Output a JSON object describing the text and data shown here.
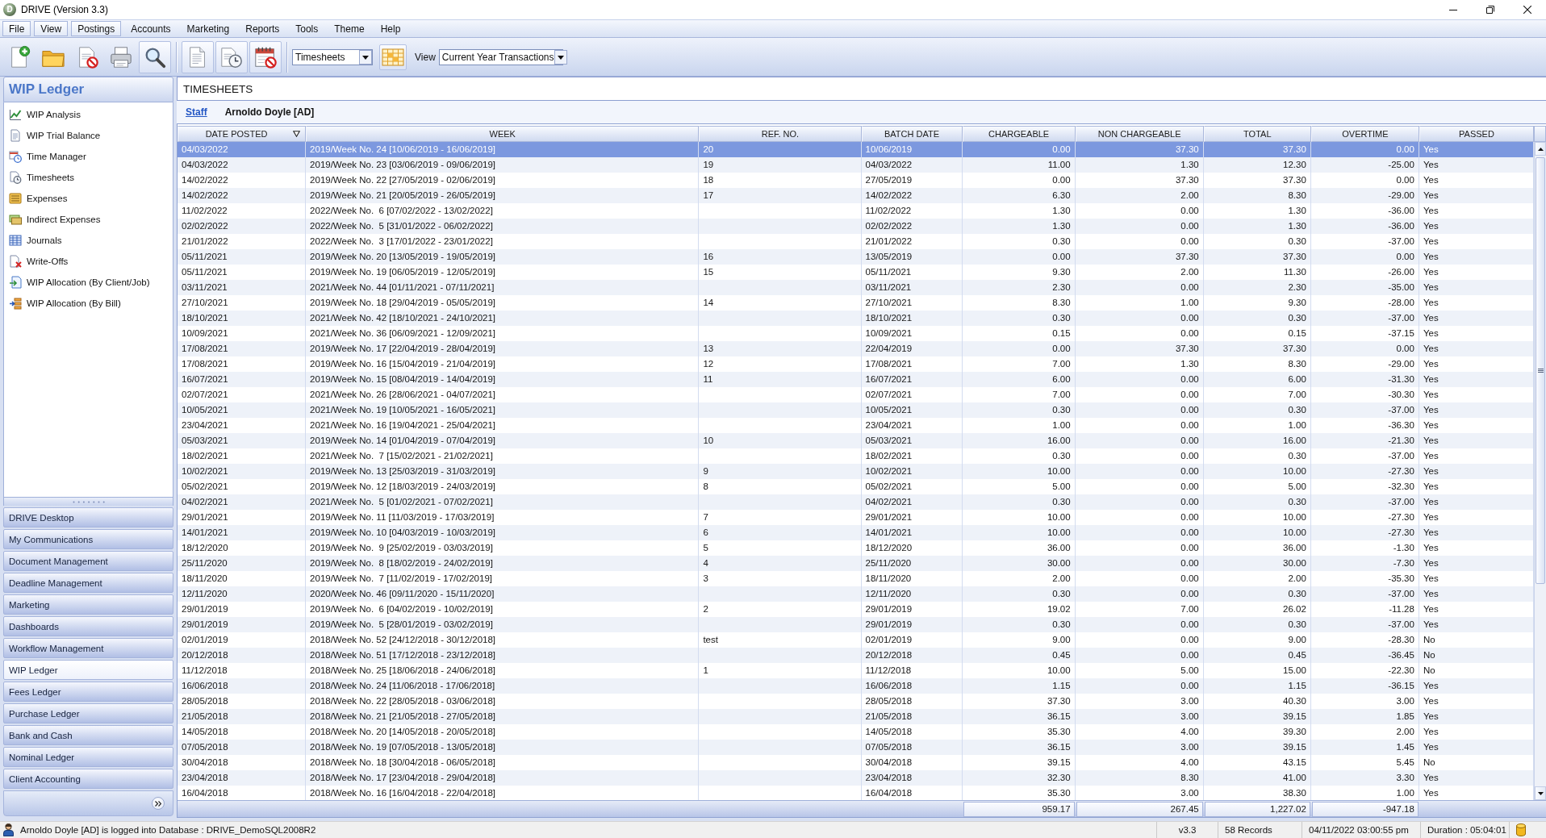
{
  "window": {
    "title": "DRIVE (Version 3.3)",
    "logo": "D"
  },
  "menu": [
    {
      "label": "File",
      "highlighted": true
    },
    {
      "label": "View",
      "highlighted": true
    },
    {
      "label": "Postings",
      "highlighted": true
    },
    {
      "label": "Accounts",
      "highlighted": false
    },
    {
      "label": "Marketing",
      "highlighted": false
    },
    {
      "label": "Reports",
      "highlighted": false
    },
    {
      "label": "Tools",
      "highlighted": false
    },
    {
      "label": "Theme",
      "highlighted": false
    },
    {
      "label": "Help",
      "highlighted": false
    }
  ],
  "toolbar": {
    "buttons": [
      {
        "highlighted": false
      },
      {
        "highlighted": false
      },
      {
        "highlighted": false
      },
      {
        "highlighted": false
      },
      {
        "highlighted": true
      },
      {
        "highlighted": true
      },
      {
        "highlighted": true
      },
      {
        "highlighted": true
      }
    ],
    "module_select": {
      "value": "Timesheets"
    },
    "view_label": "View",
    "view_select": {
      "value": "Current Year Transactions"
    }
  },
  "sidebar": {
    "title": "WIP Ledger",
    "items": [
      "WIP Analysis",
      "WIP Trial Balance",
      "Time Manager",
      "Timesheets",
      "Expenses",
      "Indirect Expenses",
      "Journals",
      "Write-Offs",
      "WIP Allocation (By Client/Job)",
      "WIP Allocation (By Bill)"
    ],
    "modules": [
      {
        "label": "DRIVE Desktop",
        "selected": false
      },
      {
        "label": "My Communications",
        "selected": false
      },
      {
        "label": "Document Management",
        "selected": false
      },
      {
        "label": "Deadline Management",
        "selected": false
      },
      {
        "label": "Marketing",
        "selected": false
      },
      {
        "label": "Dashboards",
        "selected": false
      },
      {
        "label": "Workflow Management",
        "selected": false
      },
      {
        "label": "WIP Ledger",
        "selected": true
      },
      {
        "label": "Fees Ledger",
        "selected": false
      },
      {
        "label": "Purchase Ledger",
        "selected": false
      },
      {
        "label": "Bank and Cash",
        "selected": false
      },
      {
        "label": "Nominal Ledger",
        "selected": false
      },
      {
        "label": "Client Accounting",
        "selected": false
      }
    ]
  },
  "panel": {
    "title": "TIMESHEETS",
    "staff_link": "Staff",
    "staff_name": "Arnoldo Doyle [AD]"
  },
  "table": {
    "columns": [
      {
        "label": "DATE POSTED",
        "kind": "text",
        "sorted": true
      },
      {
        "label": "WEEK",
        "kind": "text",
        "sorted": false
      },
      {
        "label": "REF. NO.",
        "kind": "text",
        "sorted": false
      },
      {
        "label": "BATCH DATE",
        "kind": "text",
        "sorted": false
      },
      {
        "label": "CHARGEABLE",
        "kind": "number",
        "sorted": false
      },
      {
        "label": "NON CHARGEABLE",
        "kind": "number",
        "sorted": false
      },
      {
        "label": "TOTAL",
        "kind": "number",
        "sorted": false
      },
      {
        "label": "OVERTIME",
        "kind": "number",
        "sorted": false
      },
      {
        "label": "PASSED",
        "kind": "text",
        "sorted": false
      }
    ],
    "rows": [
      {
        "selected": true,
        "date_posted": "04/03/2022",
        "week": "2019/Week No. 24 [10/06/2019 - 16/06/2019]",
        "ref_no": "20",
        "batch_date": "10/06/2019",
        "chargeable": "0.00",
        "non_chargeable": "37.30",
        "total": "37.30",
        "overtime": "0.00",
        "passed": "Yes"
      },
      {
        "selected": false,
        "date_posted": "04/03/2022",
        "week": "2019/Week No. 23 [03/06/2019 - 09/06/2019]",
        "ref_no": "19",
        "batch_date": "04/03/2022",
        "chargeable": "11.00",
        "non_chargeable": "1.30",
        "total": "12.30",
        "overtime": "-25.00",
        "passed": "Yes"
      },
      {
        "selected": false,
        "date_posted": "14/02/2022",
        "week": "2019/Week No. 22 [27/05/2019 - 02/06/2019]",
        "ref_no": "18",
        "batch_date": "27/05/2019",
        "chargeable": "0.00",
        "non_chargeable": "37.30",
        "total": "37.30",
        "overtime": "0.00",
        "passed": "Yes"
      },
      {
        "selected": false,
        "date_posted": "14/02/2022",
        "week": "2019/Week No. 21 [20/05/2019 - 26/05/2019]",
        "ref_no": "17",
        "batch_date": "14/02/2022",
        "chargeable": "6.30",
        "non_chargeable": "2.00",
        "total": "8.30",
        "overtime": "-29.00",
        "passed": "Yes"
      },
      {
        "selected": false,
        "date_posted": "11/02/2022",
        "week": "2022/Week No.  6 [07/02/2022 - 13/02/2022]",
        "batch_date": "11/02/2022",
        "chargeable": "1.30",
        "non_chargeable": "0.00",
        "total": "1.30",
        "overtime": "-36.00",
        "passed": "Yes"
      },
      {
        "selected": false,
        "date_posted": "02/02/2022",
        "week": "2022/Week No.  5 [31/01/2022 - 06/02/2022]",
        "batch_date": "02/02/2022",
        "chargeable": "1.30",
        "non_chargeable": "0.00",
        "total": "1.30",
        "overtime": "-36.00",
        "passed": "Yes"
      },
      {
        "selected": false,
        "date_posted": "21/01/2022",
        "week": "2022/Week No.  3 [17/01/2022 - 23/01/2022]",
        "batch_date": "21/01/2022",
        "chargeable": "0.30",
        "non_chargeable": "0.00",
        "total": "0.30",
        "overtime": "-37.00",
        "passed": "Yes"
      },
      {
        "selected": false,
        "date_posted": "05/11/2021",
        "week": "2019/Week No. 20 [13/05/2019 - 19/05/2019]",
        "ref_no": "16",
        "batch_date": "13/05/2019",
        "chargeable": "0.00",
        "non_chargeable": "37.30",
        "total": "37.30",
        "overtime": "0.00",
        "passed": "Yes"
      },
      {
        "selected": false,
        "date_posted": "05/11/2021",
        "week": "2019/Week No. 19 [06/05/2019 - 12/05/2019]",
        "ref_no": "15",
        "batch_date": "05/11/2021",
        "chargeable": "9.30",
        "non_chargeable": "2.00",
        "total": "11.30",
        "overtime": "-26.00",
        "passed": "Yes"
      },
      {
        "selected": false,
        "date_posted": "03/11/2021",
        "week": "2021/Week No. 44 [01/11/2021 - 07/11/2021]",
        "batch_date": "03/11/2021",
        "chargeable": "2.30",
        "non_chargeable": "0.00",
        "total": "2.30",
        "overtime": "-35.00",
        "passed": "Yes"
      },
      {
        "selected": false,
        "date_posted": "27/10/2021",
        "week": "2019/Week No. 18 [29/04/2019 - 05/05/2019]",
        "ref_no": "14",
        "batch_date": "27/10/2021",
        "chargeable": "8.30",
        "non_chargeable": "1.00",
        "total": "9.30",
        "overtime": "-28.00",
        "passed": "Yes"
      },
      {
        "selected": false,
        "date_posted": "18/10/2021",
        "week": "2021/Week No. 42 [18/10/2021 - 24/10/2021]",
        "batch_date": "18/10/2021",
        "chargeable": "0.30",
        "non_chargeable": "0.00",
        "total": "0.30",
        "overtime": "-37.00",
        "passed": "Yes"
      },
      {
        "selected": false,
        "date_posted": "10/09/2021",
        "week": "2021/Week No. 36 [06/09/2021 - 12/09/2021]",
        "batch_date": "10/09/2021",
        "chargeable": "0.15",
        "non_chargeable": "0.00",
        "total": "0.15",
        "overtime": "-37.15",
        "passed": "Yes"
      },
      {
        "selected": false,
        "date_posted": "17/08/2021",
        "week": "2019/Week No. 17 [22/04/2019 - 28/04/2019]",
        "ref_no": "13",
        "batch_date": "22/04/2019",
        "chargeable": "0.00",
        "non_chargeable": "37.30",
        "total": "37.30",
        "overtime": "0.00",
        "passed": "Yes"
      },
      {
        "selected": false,
        "date_posted": "17/08/2021",
        "week": "2019/Week No. 16 [15/04/2019 - 21/04/2019]",
        "ref_no": "12",
        "batch_date": "17/08/2021",
        "chargeable": "7.00",
        "non_chargeable": "1.30",
        "total": "8.30",
        "overtime": "-29.00",
        "passed": "Yes"
      },
      {
        "selected": false,
        "date_posted": "16/07/2021",
        "week": "2019/Week No. 15 [08/04/2019 - 14/04/2019]",
        "ref_no": "11",
        "batch_date": "16/07/2021",
        "chargeable": "6.00",
        "non_chargeable": "0.00",
        "total": "6.00",
        "overtime": "-31.30",
        "passed": "Yes"
      },
      {
        "selected": false,
        "date_posted": "02/07/2021",
        "week": "2021/Week No. 26 [28/06/2021 - 04/07/2021]",
        "batch_date": "02/07/2021",
        "chargeable": "7.00",
        "non_chargeable": "0.00",
        "total": "7.00",
        "overtime": "-30.30",
        "passed": "Yes"
      },
      {
        "selected": false,
        "date_posted": "10/05/2021",
        "week": "2021/Week No. 19 [10/05/2021 - 16/05/2021]",
        "batch_date": "10/05/2021",
        "chargeable": "0.30",
        "non_chargeable": "0.00",
        "total": "0.30",
        "overtime": "-37.00",
        "passed": "Yes"
      },
      {
        "selected": false,
        "date_posted": "23/04/2021",
        "week": "2021/Week No. 16 [19/04/2021 - 25/04/2021]",
        "batch_date": "23/04/2021",
        "chargeable": "1.00",
        "non_chargeable": "0.00",
        "total": "1.00",
        "overtime": "-36.30",
        "passed": "Yes"
      },
      {
        "selected": false,
        "date_posted": "05/03/2021",
        "week": "2019/Week No. 14 [01/04/2019 - 07/04/2019]",
        "ref_no": "10",
        "batch_date": "05/03/2021",
        "chargeable": "16.00",
        "non_chargeable": "0.00",
        "total": "16.00",
        "overtime": "-21.30",
        "passed": "Yes"
      },
      {
        "selected": false,
        "date_posted": "18/02/2021",
        "week": "2021/Week No.  7 [15/02/2021 - 21/02/2021]",
        "batch_date": "18/02/2021",
        "chargeable": "0.30",
        "non_chargeable": "0.00",
        "total": "0.30",
        "overtime": "-37.00",
        "passed": "Yes"
      },
      {
        "selected": false,
        "date_posted": "10/02/2021",
        "week": "2019/Week No. 13 [25/03/2019 - 31/03/2019]",
        "ref_no": "9",
        "batch_date": "10/02/2021",
        "chargeable": "10.00",
        "non_chargeable": "0.00",
        "total": "10.00",
        "overtime": "-27.30",
        "passed": "Yes"
      },
      {
        "selected": false,
        "date_posted": "05/02/2021",
        "week": "2019/Week No. 12 [18/03/2019 - 24/03/2019]",
        "ref_no": "8",
        "batch_date": "05/02/2021",
        "chargeable": "5.00",
        "non_chargeable": "0.00",
        "total": "5.00",
        "overtime": "-32.30",
        "passed": "Yes"
      },
      {
        "selected": false,
        "date_posted": "04/02/2021",
        "week": "2021/Week No.  5 [01/02/2021 - 07/02/2021]",
        "batch_date": "04/02/2021",
        "chargeable": "0.30",
        "non_chargeable": "0.00",
        "total": "0.30",
        "overtime": "-37.00",
        "passed": "Yes"
      },
      {
        "selected": false,
        "date_posted": "29/01/2021",
        "week": "2019/Week No. 11 [11/03/2019 - 17/03/2019]",
        "ref_no": "7",
        "batch_date": "29/01/2021",
        "chargeable": "10.00",
        "non_chargeable": "0.00",
        "total": "10.00",
        "overtime": "-27.30",
        "passed": "Yes"
      },
      {
        "selected": false,
        "date_posted": "14/01/2021",
        "week": "2019/Week No. 10 [04/03/2019 - 10/03/2019]",
        "ref_no": "6",
        "batch_date": "14/01/2021",
        "chargeable": "10.00",
        "non_chargeable": "0.00",
        "total": "10.00",
        "overtime": "-27.30",
        "passed": "Yes"
      },
      {
        "selected": false,
        "date_posted": "18/12/2020",
        "week": "2019/Week No.  9 [25/02/2019 - 03/03/2019]",
        "ref_no": "5",
        "batch_date": "18/12/2020",
        "chargeable": "36.00",
        "non_chargeable": "0.00",
        "total": "36.00",
        "overtime": "-1.30",
        "passed": "Yes"
      },
      {
        "selected": false,
        "date_posted": "25/11/2020",
        "week": "2019/Week No.  8 [18/02/2019 - 24/02/2019]",
        "ref_no": "4",
        "batch_date": "25/11/2020",
        "chargeable": "30.00",
        "non_chargeable": "0.00",
        "total": "30.00",
        "overtime": "-7.30",
        "passed": "Yes"
      },
      {
        "selected": false,
        "date_posted": "18/11/2020",
        "week": "2019/Week No.  7 [11/02/2019 - 17/02/2019]",
        "ref_no": "3",
        "batch_date": "18/11/2020",
        "chargeable": "2.00",
        "non_chargeable": "0.00",
        "total": "2.00",
        "overtime": "-35.30",
        "passed": "Yes"
      },
      {
        "selected": false,
        "date_posted": "12/11/2020",
        "week": "2020/Week No. 46 [09/11/2020 - 15/11/2020]",
        "batch_date": "12/11/2020",
        "chargeable": "0.30",
        "non_chargeable": "0.00",
        "total": "0.30",
        "overtime": "-37.00",
        "passed": "Yes"
      },
      {
        "selected": false,
        "date_posted": "29/01/2019",
        "week": "2019/Week No.  6 [04/02/2019 - 10/02/2019]",
        "ref_no": "2",
        "batch_date": "29/01/2019",
        "chargeable": "19.02",
        "non_chargeable": "7.00",
        "total": "26.02",
        "overtime": "-11.28",
        "passed": "Yes"
      },
      {
        "selected": false,
        "date_posted": "29/01/2019",
        "week": "2019/Week No.  5 [28/01/2019 - 03/02/2019]",
        "batch_date": "29/01/2019",
        "chargeable": "0.30",
        "non_chargeable": "0.00",
        "total": "0.30",
        "overtime": "-37.00",
        "passed": "Yes"
      },
      {
        "selected": false,
        "date_posted": "02/01/2019",
        "week": "2018/Week No. 52 [24/12/2018 - 30/12/2018]",
        "ref_no": "test",
        "batch_date": "02/01/2019",
        "chargeable": "9.00",
        "non_chargeable": "0.00",
        "total": "9.00",
        "overtime": "-28.30",
        "passed": "No"
      },
      {
        "selected": false,
        "date_posted": "20/12/2018",
        "week": "2018/Week No. 51 [17/12/2018 - 23/12/2018]",
        "batch_date": "20/12/2018",
        "chargeable": "0.45",
        "non_chargeable": "0.00",
        "total": "0.45",
        "overtime": "-36.45",
        "passed": "No"
      },
      {
        "selected": false,
        "date_posted": "11/12/2018",
        "week": "2018/Week No. 25 [18/06/2018 - 24/06/2018]",
        "ref_no": "1",
        "batch_date": "11/12/2018",
        "chargeable": "10.00",
        "non_chargeable": "5.00",
        "total": "15.00",
        "overtime": "-22.30",
        "passed": "No"
      },
      {
        "selected": false,
        "date_posted": "16/06/2018",
        "week": "2018/Week No. 24 [11/06/2018 - 17/06/2018]",
        "batch_date": "16/06/2018",
        "chargeable": "1.15",
        "non_chargeable": "0.00",
        "total": "1.15",
        "overtime": "-36.15",
        "passed": "Yes"
      },
      {
        "selected": false,
        "date_posted": "28/05/2018",
        "week": "2018/Week No. 22 [28/05/2018 - 03/06/2018]",
        "batch_date": "28/05/2018",
        "chargeable": "37.30",
        "non_chargeable": "3.00",
        "total": "40.30",
        "overtime": "3.00",
        "passed": "Yes"
      },
      {
        "selected": false,
        "date_posted": "21/05/2018",
        "week": "2018/Week No. 21 [21/05/2018 - 27/05/2018]",
        "batch_date": "21/05/2018",
        "chargeable": "36.15",
        "non_chargeable": "3.00",
        "total": "39.15",
        "overtime": "1.85",
        "passed": "Yes"
      },
      {
        "selected": false,
        "date_posted": "14/05/2018",
        "week": "2018/Week No. 20 [14/05/2018 - 20/05/2018]",
        "batch_date": "14/05/2018",
        "chargeable": "35.30",
        "non_chargeable": "4.00",
        "total": "39.30",
        "overtime": "2.00",
        "passed": "Yes"
      },
      {
        "selected": false,
        "date_posted": "07/05/2018",
        "week": "2018/Week No. 19 [07/05/2018 - 13/05/2018]",
        "batch_date": "07/05/2018",
        "chargeable": "36.15",
        "non_chargeable": "3.00",
        "total": "39.15",
        "overtime": "1.45",
        "passed": "Yes"
      },
      {
        "selected": false,
        "date_posted": "30/04/2018",
        "week": "2018/Week No. 18 [30/04/2018 - 06/05/2018]",
        "batch_date": "30/04/2018",
        "chargeable": "39.15",
        "non_chargeable": "4.00",
        "total": "43.15",
        "overtime": "5.45",
        "passed": "No"
      },
      {
        "selected": false,
        "date_posted": "23/04/2018",
        "week": "2018/Week No. 17 [23/04/2018 - 29/04/2018]",
        "batch_date": "23/04/2018",
        "chargeable": "32.30",
        "non_chargeable": "8.30",
        "total": "41.00",
        "overtime": "3.30",
        "passed": "Yes"
      },
      {
        "selected": false,
        "date_posted": "16/04/2018",
        "week": "2018/Week No. 16 [16/04/2018 - 22/04/2018]",
        "batch_date": "16/04/2018",
        "chargeable": "35.30",
        "non_chargeable": "3.00",
        "total": "38.30",
        "overtime": "1.00",
        "passed": "Yes"
      }
    ],
    "totals": {
      "chargeable": "959.17",
      "non_chargeable": "267.45",
      "total": "1,227.02",
      "overtime": "-947.18"
    }
  },
  "status_bar": {
    "message": "Arnoldo Doyle [AD] is logged into Database : DRIVE_DemoSQL2008R2",
    "version": "v3.3",
    "records": "58 Records",
    "datetime": "04/11/2022 03:00:55 pm",
    "duration": "Duration : 05:04:01"
  }
}
